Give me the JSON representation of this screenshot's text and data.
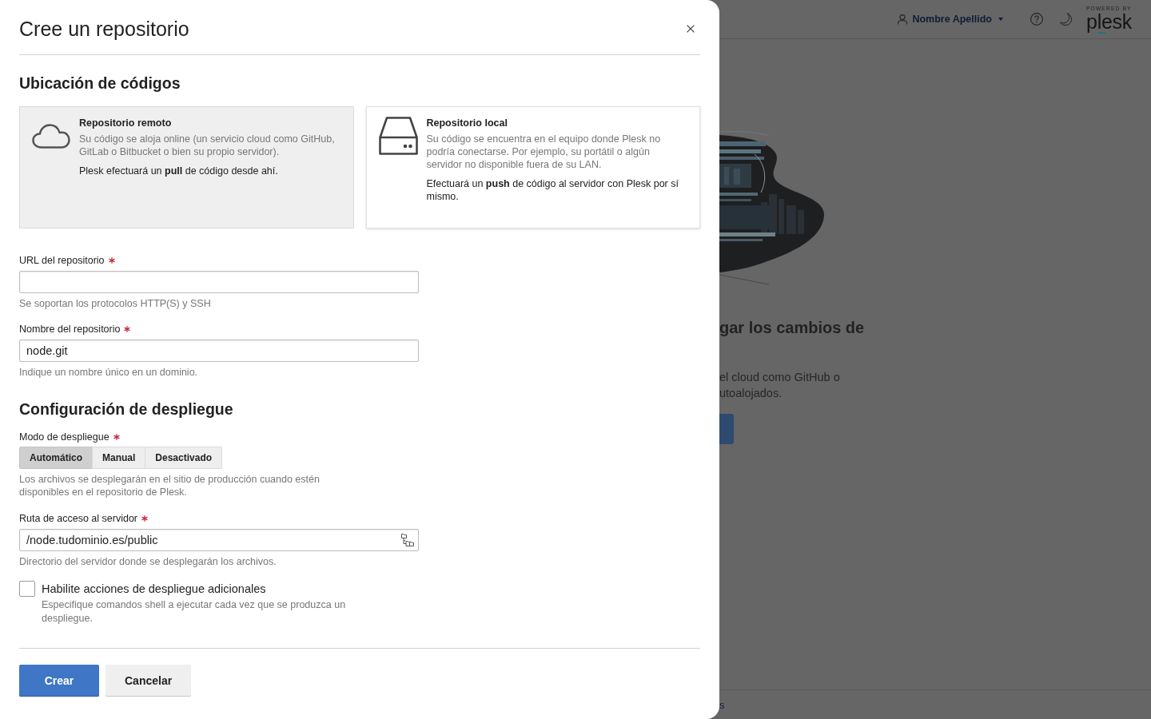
{
  "background_page": {
    "header": {
      "user_name": "Nombre Apellido",
      "logo_caption": "POWERED BY",
      "logo_name": "plesk"
    },
    "hero": {
      "heading": "gar los cambios de",
      "text": "el cloud como GitHub o\nutoalojados."
    },
    "footer": {
      "link": "s"
    }
  },
  "dialog": {
    "title": "Cree un repositorio",
    "location": {
      "heading": "Ubicación de códigos",
      "options": [
        {
          "kind": "cloud",
          "title": "Repositorio remoto",
          "description": "Su código se aloja online (un servicio cloud como GitHub, GitLab o Bitbucket o bien su propio servidor).",
          "note": "Plesk efectuará un **pull** de código desde ahí.",
          "selected": true
        },
        {
          "kind": "drive",
          "title": "Repositorio local",
          "description": "Su código se encuentra en el equipo donde Plesk no podría conectarse. Por ejemplo, su portátil o algún servidor no disponible fuera de su LAN.",
          "note": "Efectuará un **push** de código al servidor con Plesk por sí mismo.",
          "selected": false
        }
      ]
    },
    "fields": [
      {
        "label": "URL del repositorio",
        "required": true,
        "hint": "Se soportan los protocolos HTTP(S) y SSH"
      },
      {
        "label": "Nombre del repositorio",
        "required": true,
        "value": "node.git",
        "hint": "Indique un nombre único en un dominio."
      }
    ],
    "deployment": {
      "heading": "Configuración de despliegue",
      "mode": {
        "label": "Modo de despliegue",
        "required": true,
        "options": [
          {
            "label": "Automático",
            "selected": true
          },
          {
            "label": "Manual",
            "selected": false
          },
          {
            "label": "Desactivado",
            "selected": false
          }
        ],
        "hint": "Los archivos se desplegarán en el sitio de producción cuando estén disponibles en el repositorio de Plesk."
      },
      "path": {
        "label": "Ruta de acceso al servidor",
        "required": true,
        "value": "/node.tudominio.es/public",
        "hint": "Directorio del servidor donde se desplegarán los archivos."
      },
      "extra_actions": {
        "label": "Habilite acciones de despliegue adicionales",
        "checked": false,
        "description": "Especifique comandos shell a ejecutar cada vez que se produzca un despliegue."
      }
    },
    "buttons": [
      {
        "label": "Crear",
        "kind": "primary"
      },
      {
        "label": "Cancelar",
        "kind": "secondary"
      }
    ]
  }
}
